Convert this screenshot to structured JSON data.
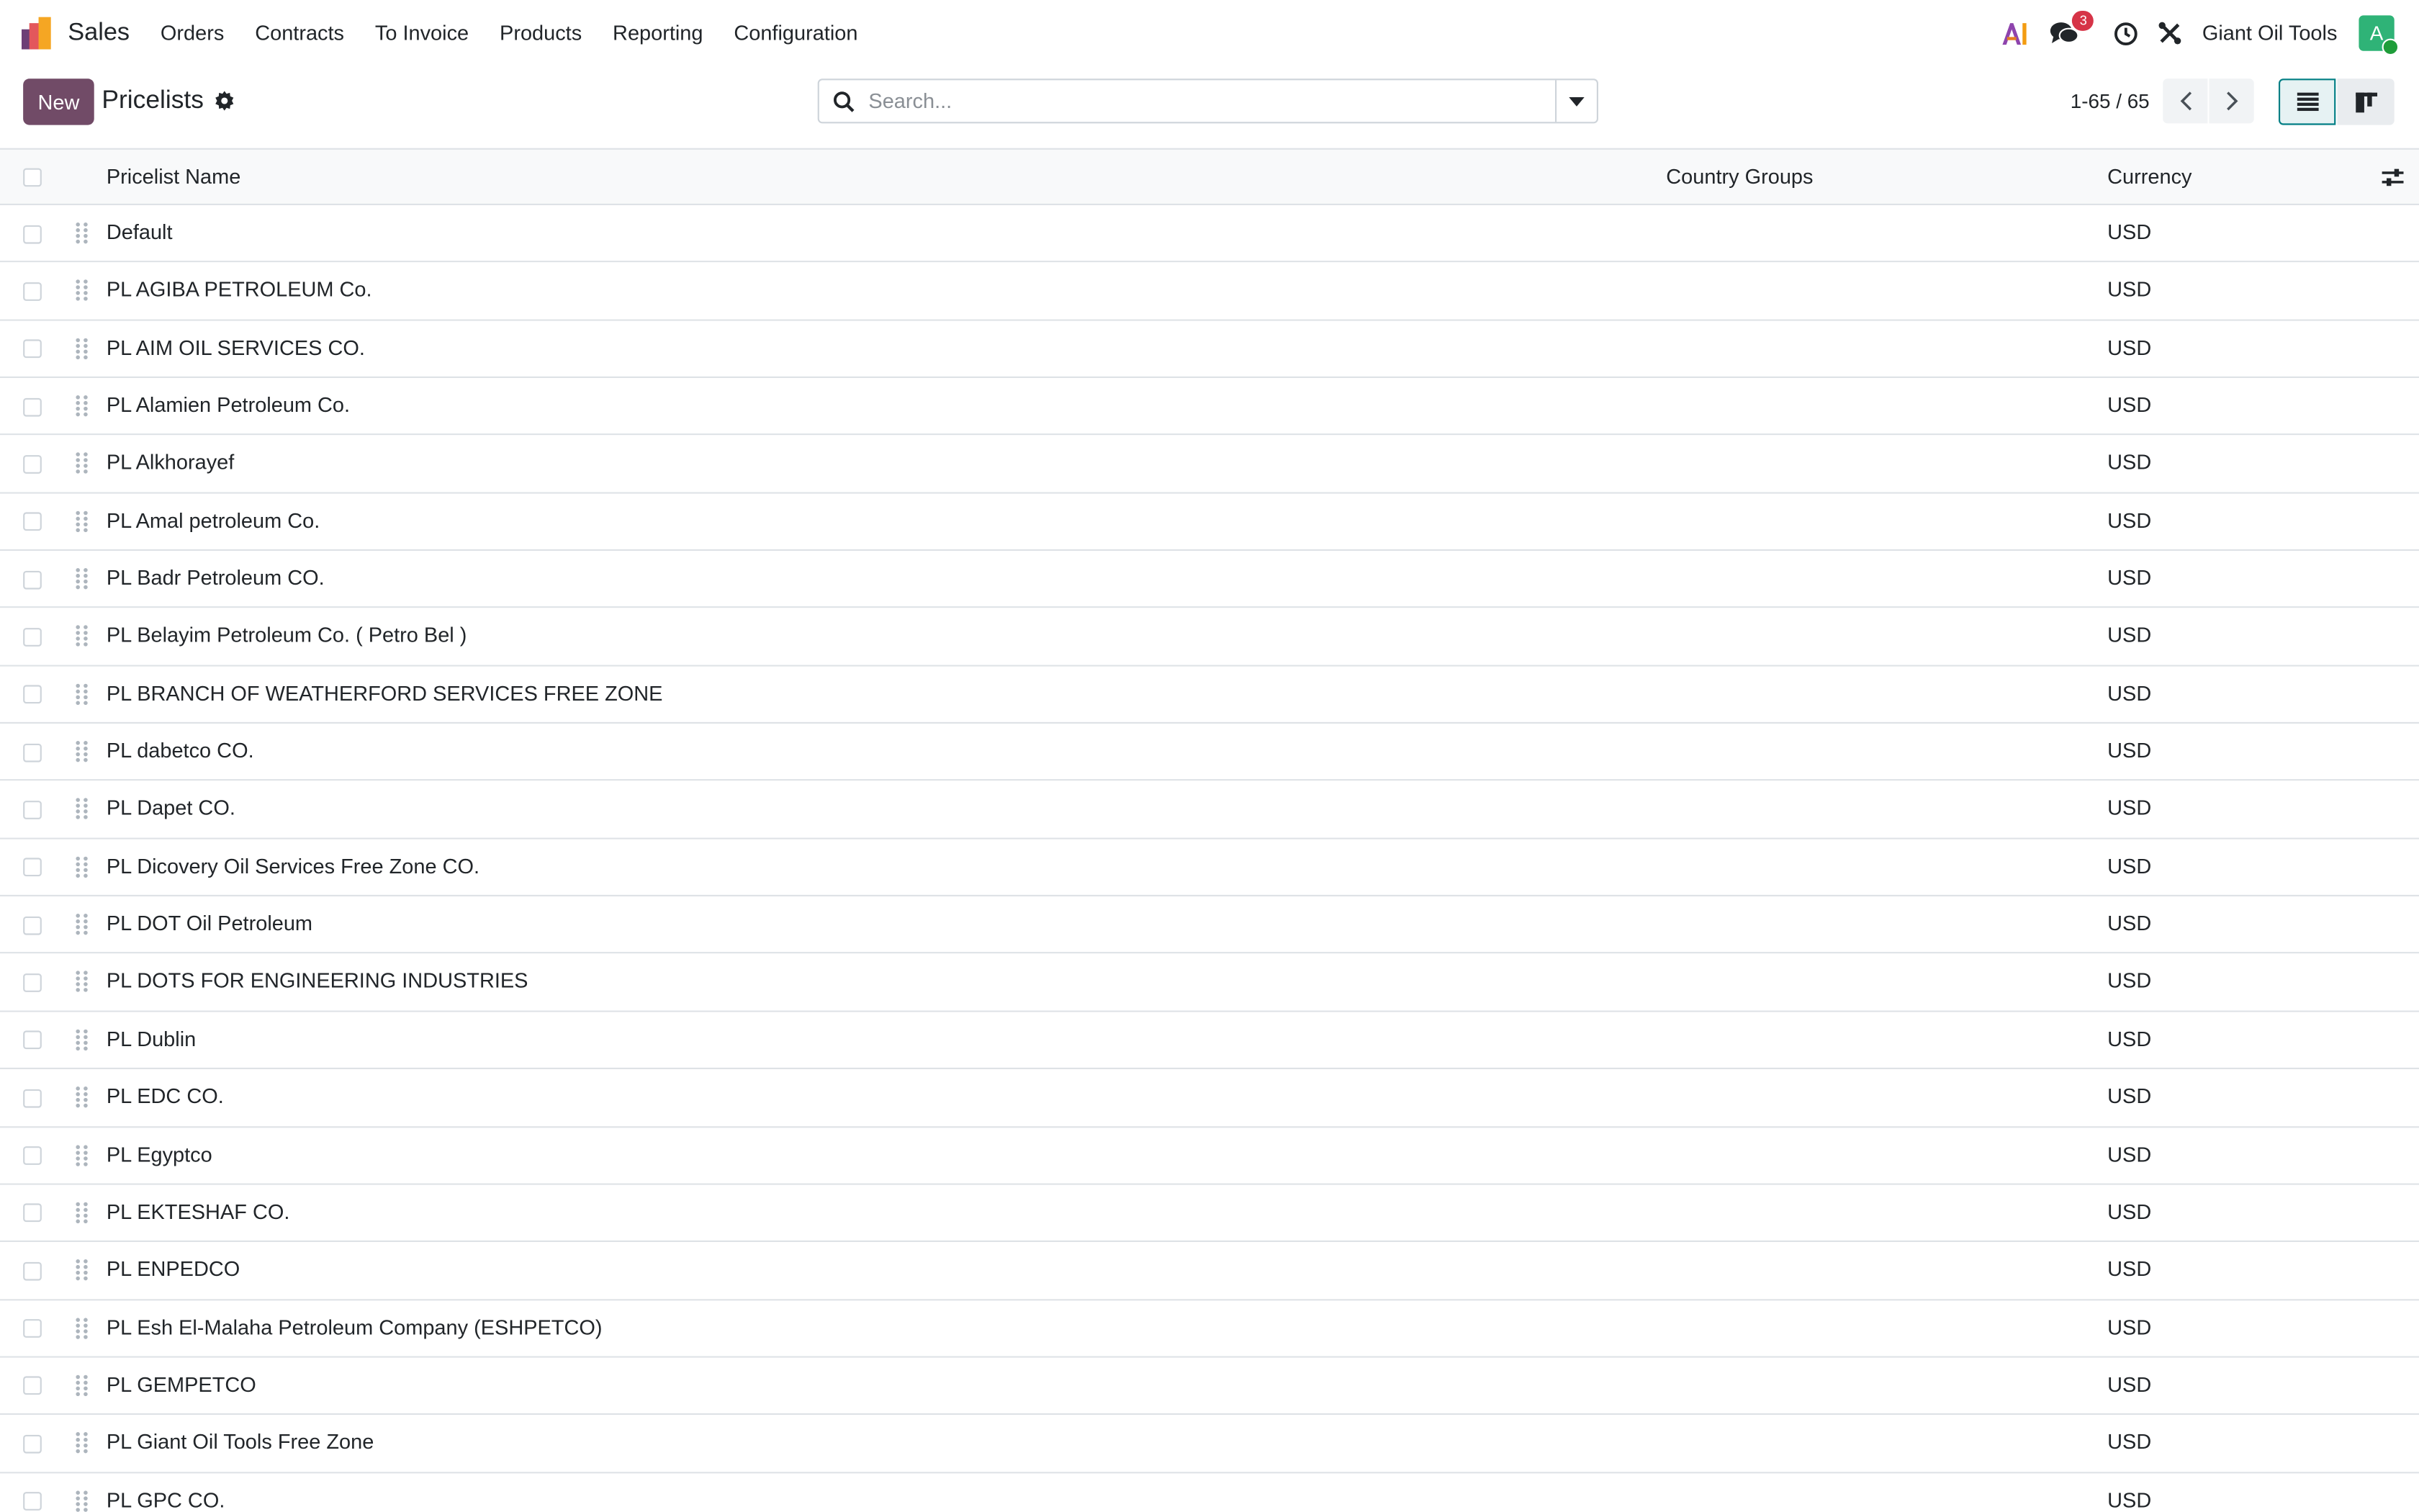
{
  "app": {
    "name": "Sales",
    "colors": {
      "brand": "#714b67",
      "accent": "#017e84",
      "badge": "#d63447",
      "avatar": "#2fb377"
    }
  },
  "menu": [
    {
      "label": "Orders"
    },
    {
      "label": "Contracts"
    },
    {
      "label": "To Invoice"
    },
    {
      "label": "Products"
    },
    {
      "label": "Reporting"
    },
    {
      "label": "Configuration"
    }
  ],
  "systray": {
    "icons": [
      "ai-icon",
      "chat-icon",
      "clock-icon",
      "tools-icon"
    ],
    "message_count": "3",
    "company": "Giant Oil Tools",
    "avatar_letter": "A"
  },
  "control_panel": {
    "new_label": "New",
    "title": "Pricelists",
    "search_placeholder": "Search...",
    "pager": "1-65 / 65"
  },
  "table": {
    "columns": {
      "name": "Pricelist Name",
      "country_groups": "Country Groups",
      "currency": "Currency"
    },
    "rows": [
      {
        "name": "Default",
        "currency": "USD"
      },
      {
        "name": "PL AGIBA PETROLEUM Co.",
        "currency": "USD"
      },
      {
        "name": "PL AIM OIL SERVICES CO.",
        "currency": "USD"
      },
      {
        "name": "PL Alamien Petroleum Co.",
        "currency": "USD"
      },
      {
        "name": "PL Alkhorayef",
        "currency": "USD"
      },
      {
        "name": "PL Amal petroleum Co.",
        "currency": "USD"
      },
      {
        "name": "PL Badr Petroleum CO.",
        "currency": "USD"
      },
      {
        "name": "PL Belayim Petroleum Co. ( Petro Bel )",
        "currency": "USD"
      },
      {
        "name": "PL BRANCH OF WEATHERFORD SERVICES FREE ZONE",
        "currency": "USD"
      },
      {
        "name": "PL dabetco CO.",
        "currency": "USD"
      },
      {
        "name": "PL Dapet CO.",
        "currency": "USD"
      },
      {
        "name": "PL Dicovery Oil Services Free Zone CO.",
        "currency": "USD"
      },
      {
        "name": "PL DOT Oil Petroleum",
        "currency": "USD"
      },
      {
        "name": "PL DOTS FOR ENGINEERING INDUSTRIES",
        "currency": "USD"
      },
      {
        "name": "PL Dublin",
        "currency": "USD"
      },
      {
        "name": "PL EDC CO.",
        "currency": "USD"
      },
      {
        "name": "PL Egyptco",
        "currency": "USD"
      },
      {
        "name": "PL EKTESHAF CO.",
        "currency": "USD"
      },
      {
        "name": "PL ENPEDCO",
        "currency": "USD"
      },
      {
        "name": "PL Esh El-Malaha Petroleum Company (ESHPETCO)",
        "currency": "USD"
      },
      {
        "name": "PL GEMPETCO",
        "currency": "USD"
      },
      {
        "name": "PL Giant Oil Tools Free Zone",
        "currency": "USD"
      },
      {
        "name": "PL GPC CO.",
        "currency": "USD"
      }
    ]
  }
}
